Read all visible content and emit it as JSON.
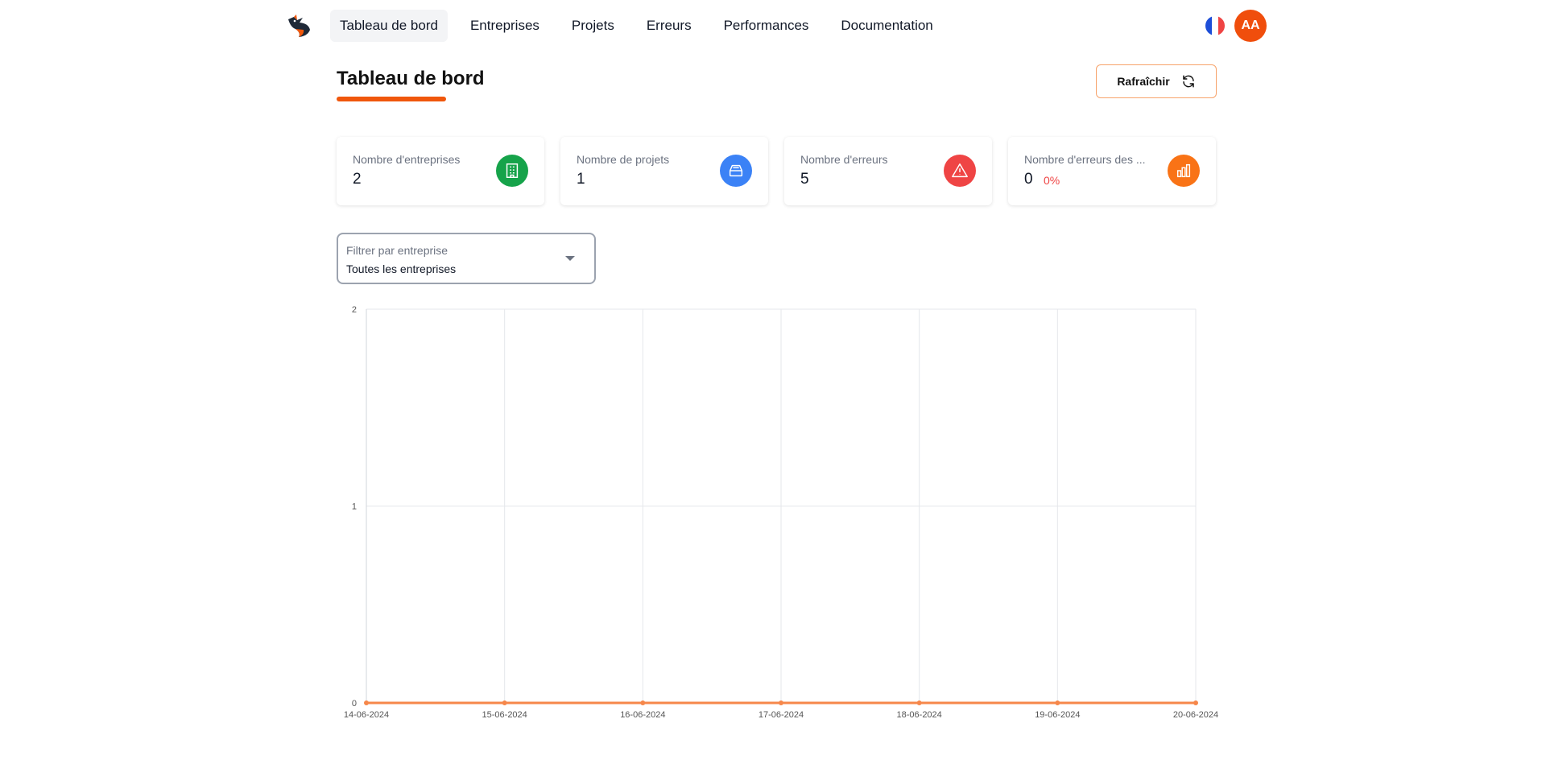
{
  "nav": {
    "items": [
      {
        "label": "Tableau de bord",
        "active": true
      },
      {
        "label": "Entreprises",
        "active": false
      },
      {
        "label": "Projets",
        "active": false
      },
      {
        "label": "Erreurs",
        "active": false
      },
      {
        "label": "Performances",
        "active": false
      },
      {
        "label": "Documentation",
        "active": false
      }
    ],
    "language_icon": "flag-france-icon",
    "avatar_initials": "AA"
  },
  "page": {
    "title": "Tableau de bord",
    "refresh_label": "Rafraîchir"
  },
  "stats": [
    {
      "label": "Nombre d'entreprises",
      "value": "2",
      "icon": "building-icon",
      "color": "#16a34a"
    },
    {
      "label": "Nombre de projets",
      "value": "1",
      "icon": "inbox-icon",
      "color": "#3b82f6"
    },
    {
      "label": "Nombre d'erreurs",
      "value": "5",
      "icon": "warning-icon",
      "color": "#ef4444"
    },
    {
      "label": "Nombre d'erreurs des ...",
      "value": "0",
      "percent": "0%",
      "icon": "bar-chart-icon",
      "color": "#f97316"
    }
  ],
  "filter": {
    "label": "Filtrer par entreprise",
    "value": "Toutes les entreprises"
  },
  "colors": {
    "accent": "#f0570c",
    "series": "#f6874a"
  },
  "chart_data": {
    "type": "line",
    "x": [
      "14-06-2024",
      "15-06-2024",
      "16-06-2024",
      "17-06-2024",
      "18-06-2024",
      "19-06-2024",
      "20-06-2024"
    ],
    "series": [
      {
        "values": [
          0,
          0,
          0,
          0,
          0,
          0,
          0
        ]
      }
    ],
    "ylim": [
      0,
      2
    ],
    "yticks": [
      0,
      1,
      2
    ],
    "grid": true,
    "legend": "none"
  }
}
